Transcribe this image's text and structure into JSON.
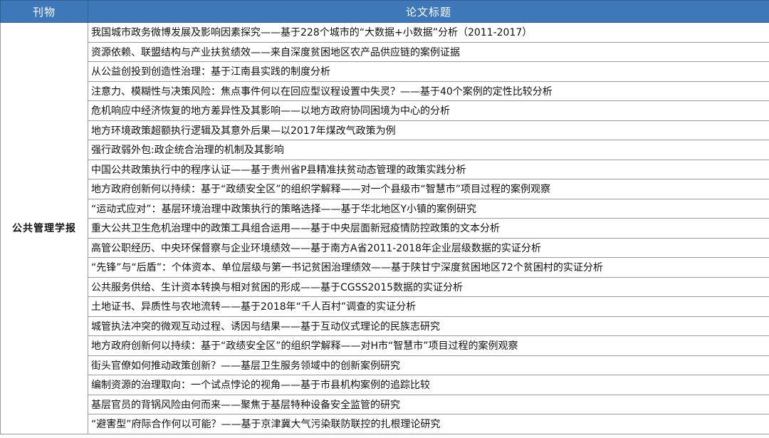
{
  "table": {
    "headers": [
      "刊物",
      "论文标题"
    ],
    "journal": "公共管理学报",
    "titles": [
      "我国城市政务微博发展及影响因素探究——基于228个城市的“大数据+小数据”分析（2011-2017）",
      "资源依赖、联盟结构与产业扶贫绩效——来自深度贫困地区农产品供应链的案例证据",
      "从公益创投到创造性治理：基于江南县实践的制度分析",
      "注意力、模糊性与决策风险：焦点事件何以在回应型议程设置中失灵？——基于40个案例的定性比较分析",
      "危机响应中经济恢复的地方差异性及其影响——以地方政府协同困境为中心的分析",
      "地方环境政策超额执行逻辑及其意外后果—以2017年煤改气政策为例",
      "强行政弱外包:政企统合治理的机制及其影响",
      "中国公共政策执行中的程序认证——基于贵州省P县精准扶贫动态管理的政策实践分析",
      "地方政府创新何以持续：基于“政绩安全区”的组织学解释——对一个县级市“智慧市”项目过程的案例观察",
      "“运动式应对”：基层环境治理中政策执行的策略选择——基于华北地区Y小镇的案例研究",
      "重大公共卫生危机治理中的政策工具组合运用——基于中央层面新冠疫情防控政策的文本分析",
      "高管公职经历、中央环保督察与企业环境绩效——基于南方A省2011-2018年企业层级数据的实证分析",
      "“先锋”与“后盾”：个体资本、单位层级与第一书记贫困治理绩效——基于陕甘宁深度贫困地区72个贫困村的实证分析",
      "公共服务供给、生计资本转换与相对贫困的形成——基于CGSS2015数据的实证分析",
      "土地证书、异质性与农地流转——基于2018年“千人百村”调查的实证分析",
      "城管执法冲突的微观互动过程、诱因与结果——基于互动仪式理论的民族志研究",
      "地方政府创新何以持续：基于“政绩安全区”的组织学解释——对H市“智慧市”项目过程的案例观察",
      "街头官僚如何推动政策创新？——基层卫生服务领域中的创新案例研究",
      "编制资源的治理取向：一个试点悖论的视角——基于市县机构案例的追踪比较",
      "基层官员的背锅风险由何而来——聚焦于基层特种设备安全监管的研究",
      "“避害型”府际合作何以可能？——基于京津冀大气污染联防联控的扎根理论研究"
    ]
  }
}
